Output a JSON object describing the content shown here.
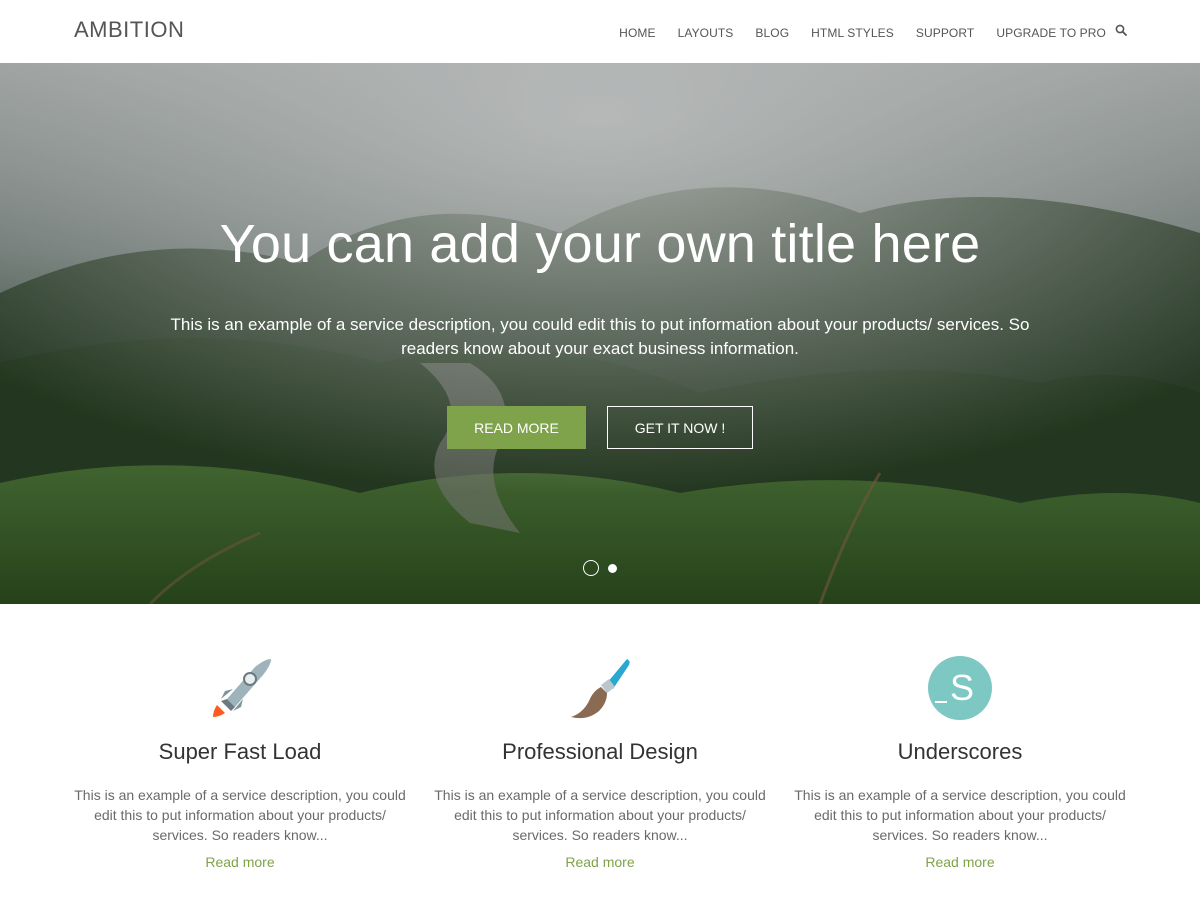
{
  "header": {
    "logo": "AMBITION",
    "nav": [
      "HOME",
      "LAYOUTS",
      "BLOG",
      "HTML STYLES",
      "SUPPORT",
      "UPGRADE TO PRO"
    ],
    "search_icon": "search-icon"
  },
  "hero": {
    "title": "You can add your own title here",
    "description": "This is an example of a service description, you could edit this to put information about your products/ services. So readers know about your exact business information.",
    "primary_button": "READ MORE",
    "secondary_button": "GET IT NOW !",
    "slides": 2,
    "active_slide": 1,
    "background": "misty forest hillside",
    "accent_color": "#7fa34a"
  },
  "services": [
    {
      "icon": "rocket-icon",
      "title": "Super Fast Load",
      "text": "This is an example of a service description, you could edit this to put information about your products/ services. So readers know...",
      "link": "Read more"
    },
    {
      "icon": "paintbrush-icon",
      "title": "Professional Design",
      "text": "This is an example of a service description, you could edit this to put information about your products/ services. So readers know...",
      "link": "Read more"
    },
    {
      "icon": "underscores-logo-icon",
      "title": "Underscores",
      "text": "This is an example of a service description, you could edit this to put information about your products/ services. So readers know...",
      "link": "Read more"
    }
  ]
}
